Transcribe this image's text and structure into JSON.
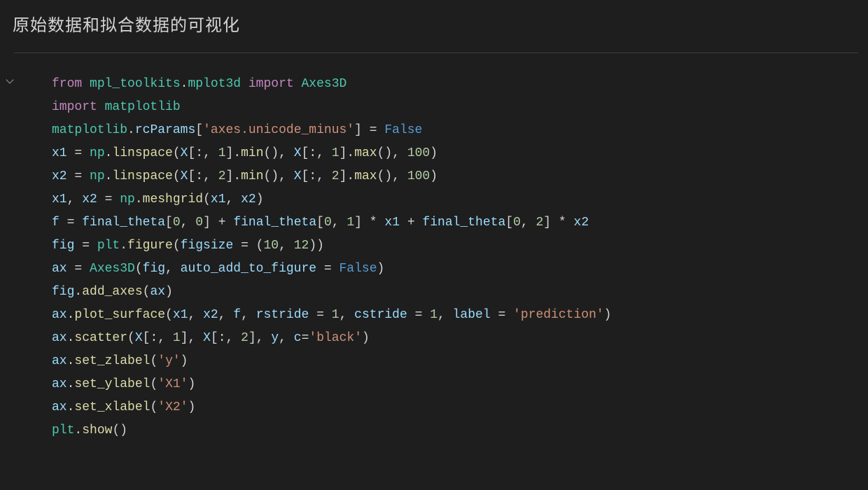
{
  "heading": "原始数据和拟合数据的可视化",
  "code": {
    "l1": {
      "s1": "from ",
      "s2": "mpl_toolkits",
      "s3": ".",
      "s4": "mplot3d",
      "s5": " import ",
      "s6": "Axes3D"
    },
    "l2": {
      "s1": "import ",
      "s2": "matplotlib"
    },
    "l3": {
      "s1": "matplotlib",
      "s2": ".",
      "s3": "rcParams",
      "s4": "[",
      "s5": "'axes.unicode_minus'",
      "s6": "] = ",
      "s7": "False"
    },
    "l4": {
      "s1": "x1",
      "s2": " = ",
      "s3": "np",
      "s4": ".",
      "s5": "linspace",
      "s6": "(",
      "s7": "X",
      "s8": "[:, ",
      "s9": "1",
      "s10": "].",
      "s11": "min",
      "s12": "(), ",
      "s13": "X",
      "s14": "[:, ",
      "s15": "1",
      "s16": "].",
      "s17": "max",
      "s18": "(), ",
      "s19": "100",
      "s20": ")"
    },
    "l5": {
      "s1": "x2",
      "s2": " = ",
      "s3": "np",
      "s4": ".",
      "s5": "linspace",
      "s6": "(",
      "s7": "X",
      "s8": "[:, ",
      "s9": "2",
      "s10": "].",
      "s11": "min",
      "s12": "(), ",
      "s13": "X",
      "s14": "[:, ",
      "s15": "2",
      "s16": "].",
      "s17": "max",
      "s18": "(), ",
      "s19": "100",
      "s20": ")"
    },
    "l6": {
      "s1": "x1",
      "s2": ", ",
      "s3": "x2",
      "s4": " = ",
      "s5": "np",
      "s6": ".",
      "s7": "meshgrid",
      "s8": "(",
      "s9": "x1",
      "s10": ", ",
      "s11": "x2",
      "s12": ")"
    },
    "l7": {
      "s1": "f",
      "s2": " = ",
      "s3": "final_theta",
      "s4": "[",
      "s5": "0",
      "s6": ", ",
      "s7": "0",
      "s8": "] + ",
      "s9": "final_theta",
      "s10": "[",
      "s11": "0",
      "s12": ", ",
      "s13": "1",
      "s14": "] * ",
      "s15": "x1",
      "s16": " + ",
      "s17": "final_theta",
      "s18": "[",
      "s19": "0",
      "s20": ", ",
      "s21": "2",
      "s22": "] * ",
      "s23": "x2"
    },
    "l8": {
      "s1": "fig",
      "s2": " = ",
      "s3": "plt",
      "s4": ".",
      "s5": "figure",
      "s6": "(",
      "s7": "figsize",
      "s8": " = (",
      "s9": "10",
      "s10": ", ",
      "s11": "12",
      "s12": "))"
    },
    "l9": {
      "s1": "ax",
      "s2": " = ",
      "s3": "Axes3D",
      "s4": "(",
      "s5": "fig",
      "s6": ", ",
      "s7": "auto_add_to_figure",
      "s8": " = ",
      "s9": "False",
      "s10": ")"
    },
    "l10": {
      "s1": "fig",
      "s2": ".",
      "s3": "add_axes",
      "s4": "(",
      "s5": "ax",
      "s6": ")"
    },
    "l11": {
      "s1": "ax",
      "s2": ".",
      "s3": "plot_surface",
      "s4": "(",
      "s5": "x1",
      "s6": ", ",
      "s7": "x2",
      "s8": ", ",
      "s9": "f",
      "s10": ", ",
      "s11": "rstride",
      "s12": " = ",
      "s13": "1",
      "s14": ", ",
      "s15": "cstride",
      "s16": " = ",
      "s17": "1",
      "s18": ", ",
      "s19": "label",
      "s20": " = ",
      "s21": "'prediction'",
      "s22": ")"
    },
    "l12": {
      "s1": "ax",
      "s2": ".",
      "s3": "scatter",
      "s4": "(",
      "s5": "X",
      "s6": "[:, ",
      "s7": "1",
      "s8": "], ",
      "s9": "X",
      "s10": "[:, ",
      "s11": "2",
      "s12": "], ",
      "s13": "y",
      "s14": ", ",
      "s15": "c",
      "s16": "=",
      "s17": "'black'",
      "s18": ")"
    },
    "l13": {
      "s1": "ax",
      "s2": ".",
      "s3": "set_zlabel",
      "s4": "(",
      "s5": "'y'",
      "s6": ")"
    },
    "l14": {
      "s1": "ax",
      "s2": ".",
      "s3": "set_ylabel",
      "s4": "(",
      "s5": "'X1'",
      "s6": ")"
    },
    "l15": {
      "s1": "ax",
      "s2": ".",
      "s3": "set_xlabel",
      "s4": "(",
      "s5": "'X2'",
      "s6": ")"
    },
    "l16": {
      "s1": "plt",
      "s2": ".",
      "s3": "show",
      "s4": "()"
    }
  }
}
